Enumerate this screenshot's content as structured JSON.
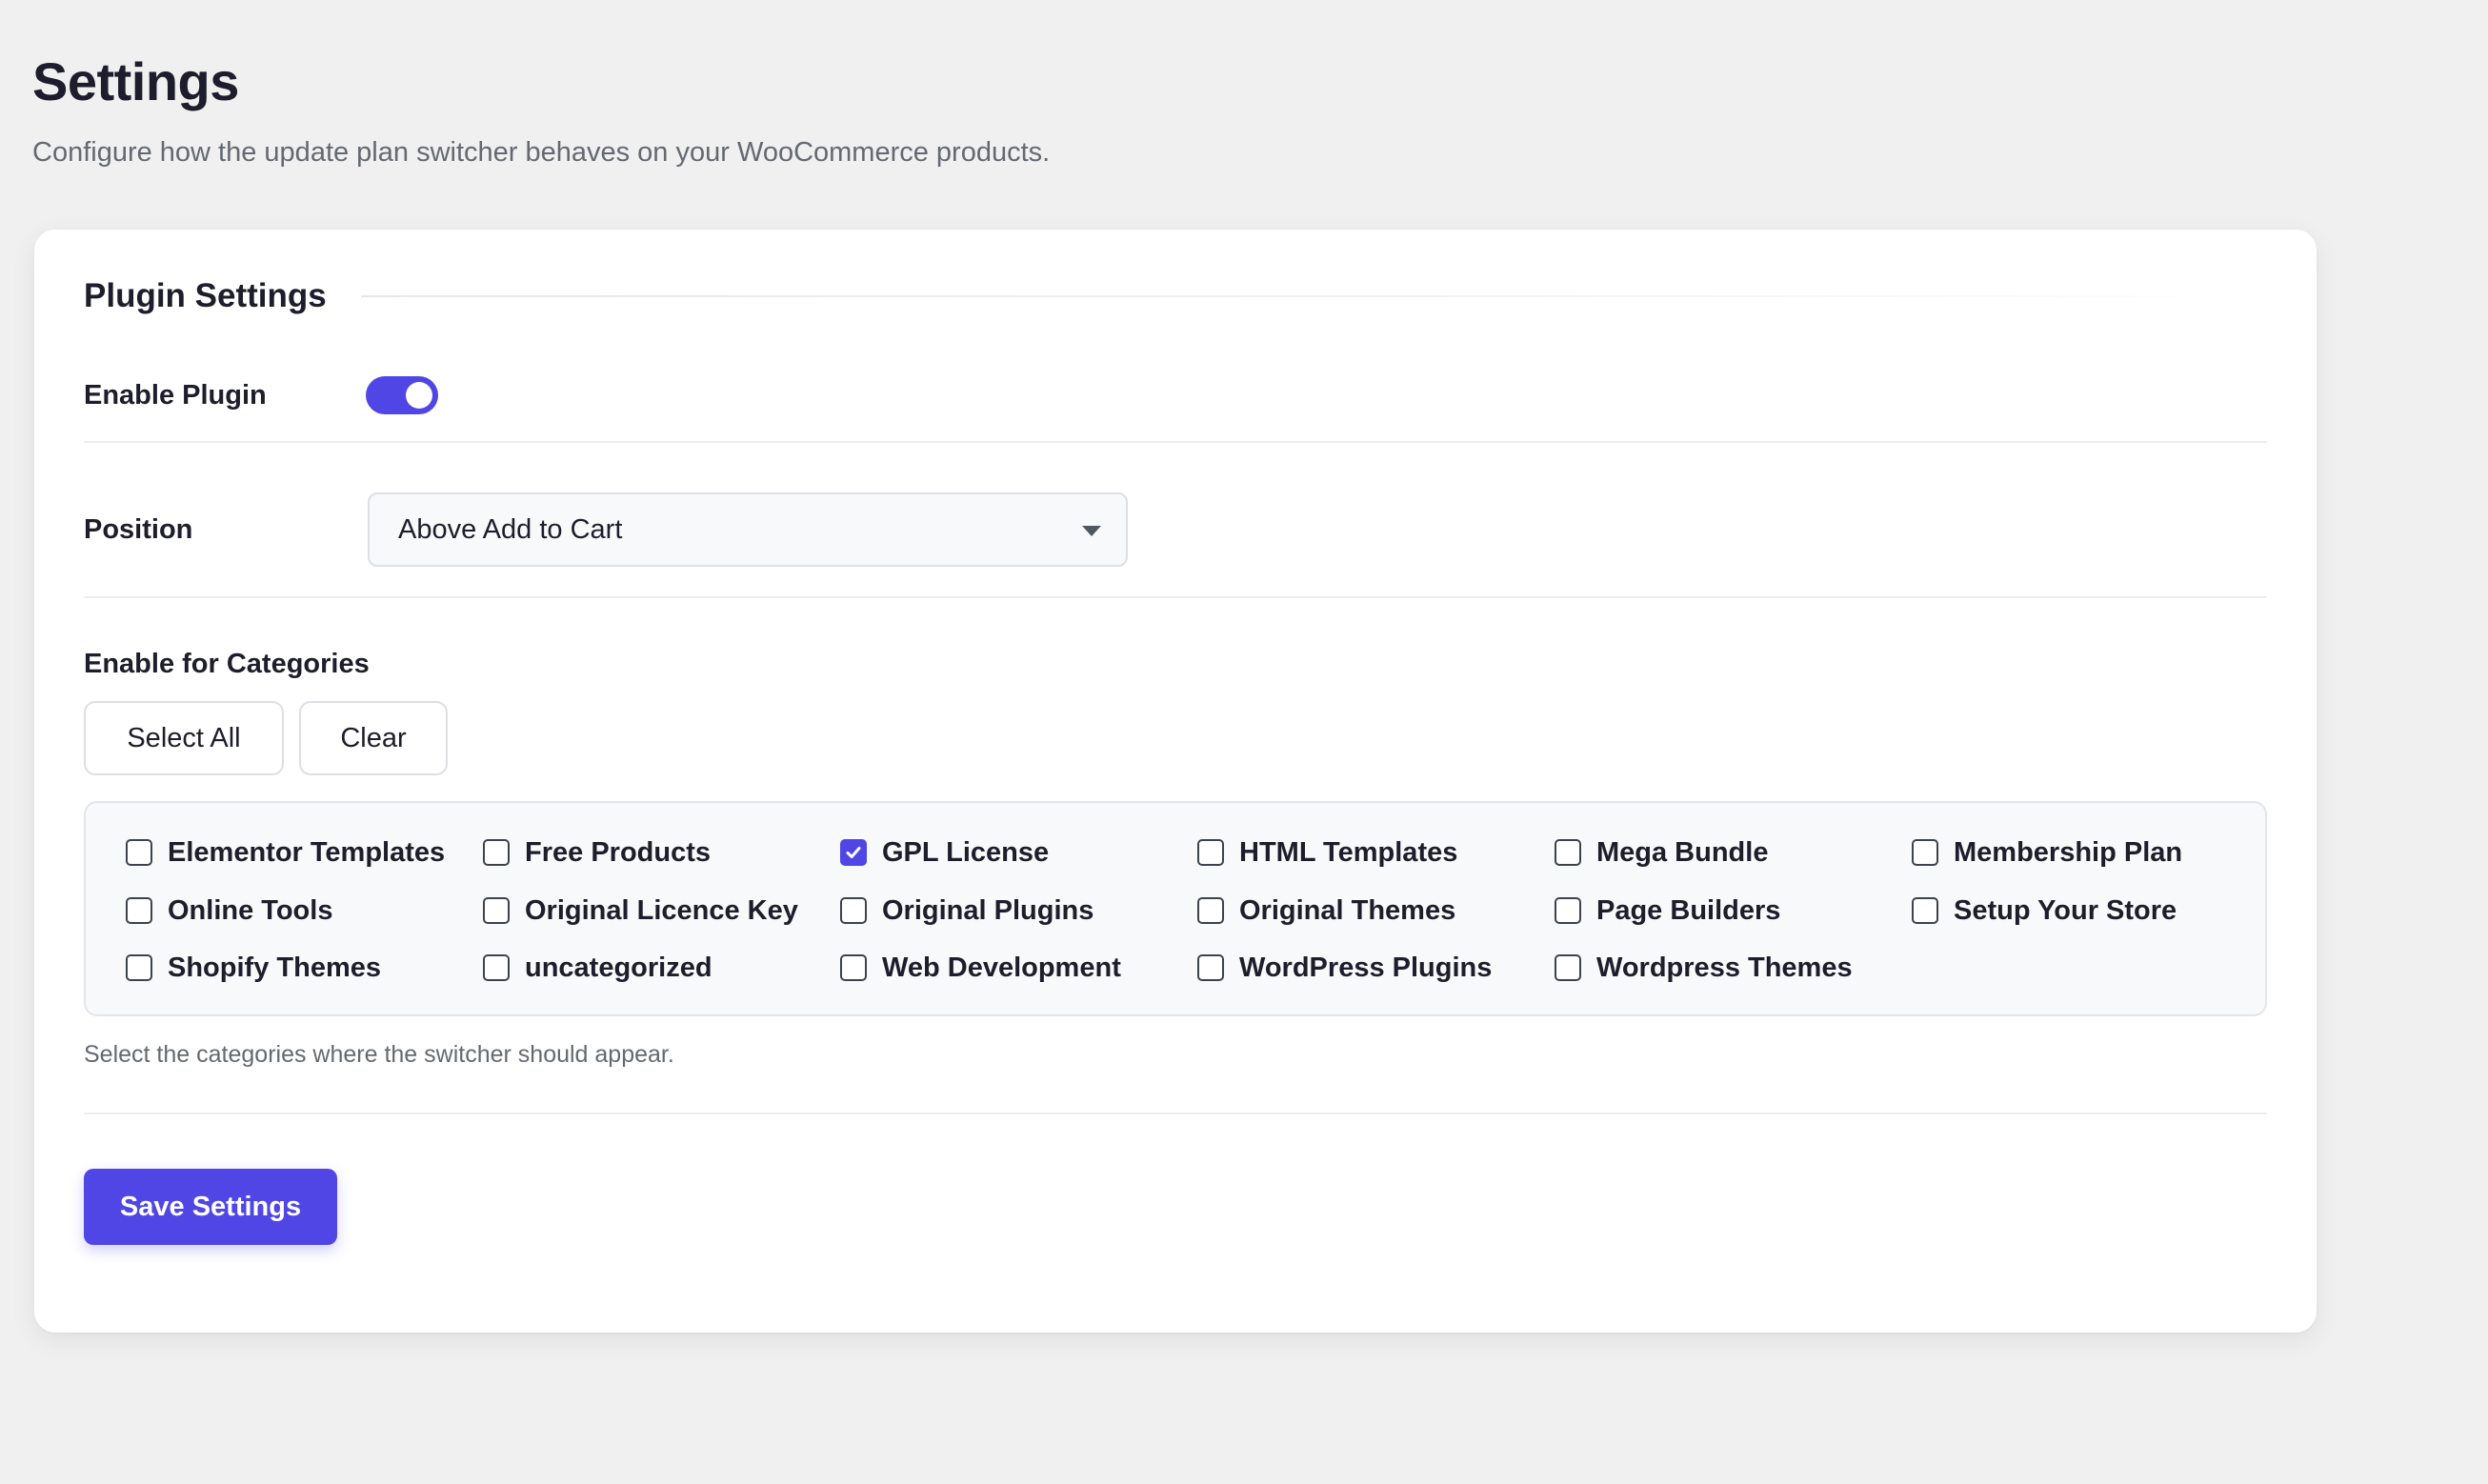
{
  "page": {
    "title": "Settings",
    "subtitle": "Configure how the update plan switcher behaves on your WooCommerce products."
  },
  "plugin_settings": {
    "section_title": "Plugin Settings",
    "enable_plugin": {
      "label": "Enable Plugin",
      "enabled": true
    },
    "position": {
      "label": "Position",
      "selected": "Above Add to Cart",
      "icon": "chevron-down-icon"
    },
    "categories": {
      "label": "Enable for Categories",
      "select_all_label": "Select All",
      "clear_label": "Clear",
      "items": [
        {
          "label": "Elementor Templates",
          "checked": false
        },
        {
          "label": "Free Products",
          "checked": false
        },
        {
          "label": "GPL License",
          "checked": true
        },
        {
          "label": "HTML Templates",
          "checked": false
        },
        {
          "label": "Mega Bundle",
          "checked": false
        },
        {
          "label": "Membership Plan",
          "checked": false
        },
        {
          "label": "Online Tools",
          "checked": false
        },
        {
          "label": "Original Licence Key",
          "checked": false
        },
        {
          "label": "Original Plugins",
          "checked": false
        },
        {
          "label": "Original Themes",
          "checked": false
        },
        {
          "label": "Page Builders",
          "checked": false
        },
        {
          "label": "Setup Your Store",
          "checked": false
        },
        {
          "label": "Shopify Themes",
          "checked": false
        },
        {
          "label": "uncategorized",
          "checked": false
        },
        {
          "label": "Web Development",
          "checked": false
        },
        {
          "label": "WordPress Plugins",
          "checked": false
        },
        {
          "label": "Wordpress Themes",
          "checked": false
        }
      ],
      "help": "Select the categories where the switcher should appear."
    },
    "save_label": "Save Settings"
  },
  "colors": {
    "accent": "#4f46e5",
    "background": "#f0f0f1",
    "card": "#ffffff",
    "text": "#1d1d2b",
    "muted": "#646970"
  }
}
